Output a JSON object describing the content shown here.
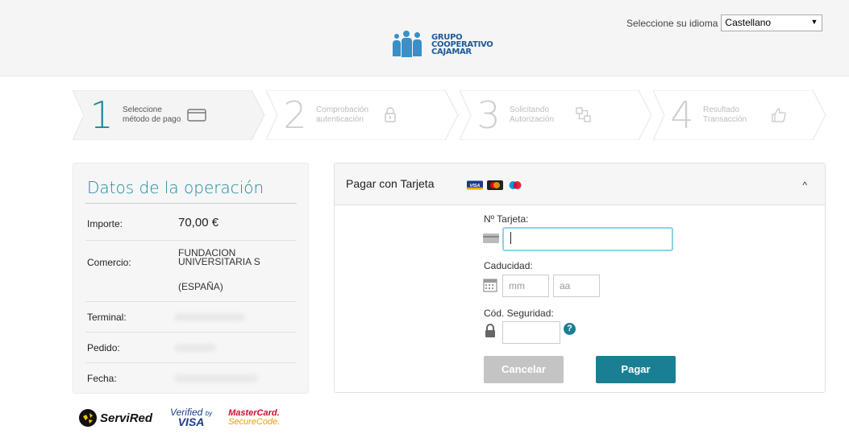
{
  "header": {
    "logo_lines": [
      "GRUPO",
      "COOPERATIVO",
      "CAJAMAR"
    ],
    "language_label": "Seleccione su idioma",
    "language_value": "Castellano"
  },
  "steps": [
    {
      "number": "1",
      "line1": "Seleccione",
      "line2": "método de pago",
      "icon": "credit-card-icon",
      "active": true
    },
    {
      "number": "2",
      "line1": "Comprobación",
      "line2": "autenticación",
      "icon": "padlock-icon",
      "active": false
    },
    {
      "number": "3",
      "line1": "Solicitando",
      "line2": "Autorización",
      "icon": "network-icon",
      "active": false
    },
    {
      "number": "4",
      "line1": "Resultado",
      "line2": "Transacción",
      "icon": "thumbs-up-icon",
      "active": false
    }
  ],
  "datos": {
    "title": "Datos de la operación",
    "importe_label": "Importe:",
    "importe_value": "70,00 €",
    "comercio_label": "Comercio:",
    "comercio_value_1": "FUNDACION",
    "comercio_value_2": "UNIVERSITARIA S",
    "comercio_value_3": "(ESPAÑA)",
    "terminal_label": "Terminal:",
    "pedido_label": "Pedido:",
    "fecha_label": "Fecha:"
  },
  "payment": {
    "title": "Pagar con Tarjeta",
    "card_brands": [
      "VISA",
      "MasterCard",
      "Maestro"
    ],
    "card_number_label": "Nº Tarjeta:",
    "card_number_value": "",
    "expiry_label": "Caducidad:",
    "month_placeholder": "mm",
    "year_placeholder": "aa",
    "cvv_label": "Cód. Seguridad:",
    "cvv_value": "",
    "help_glyph": "?",
    "cancel_label": "Cancelar",
    "pay_label": "Pagar"
  },
  "footer_brands": {
    "servired": "ServiRed",
    "verified_line1": "Verified",
    "verified_by": "by",
    "verified_line2": "VISA",
    "mastercard_line1": "MasterCard.",
    "mastercard_line2": "SecureCode."
  },
  "colors": {
    "accent": "#1b7f93",
    "title_teal": "#1f8a9e",
    "logo_blue": "#1e5a99",
    "cancel_gray": "#c4c4c4"
  }
}
